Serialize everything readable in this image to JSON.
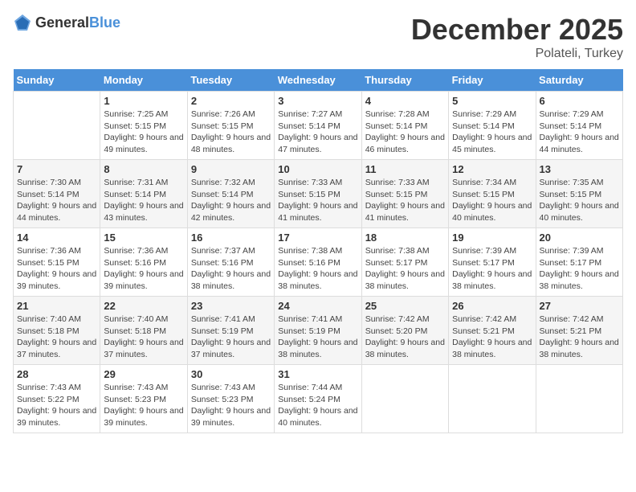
{
  "logo": {
    "text_general": "General",
    "text_blue": "Blue"
  },
  "header": {
    "month": "December 2025",
    "location": "Polateli, Turkey"
  },
  "weekdays": [
    "Sunday",
    "Monday",
    "Tuesday",
    "Wednesday",
    "Thursday",
    "Friday",
    "Saturday"
  ],
  "weeks": [
    [
      {
        "day": "",
        "sunrise": "",
        "sunset": "",
        "daylight": ""
      },
      {
        "day": "1",
        "sunrise": "Sunrise: 7:25 AM",
        "sunset": "Sunset: 5:15 PM",
        "daylight": "Daylight: 9 hours and 49 minutes."
      },
      {
        "day": "2",
        "sunrise": "Sunrise: 7:26 AM",
        "sunset": "Sunset: 5:15 PM",
        "daylight": "Daylight: 9 hours and 48 minutes."
      },
      {
        "day": "3",
        "sunrise": "Sunrise: 7:27 AM",
        "sunset": "Sunset: 5:14 PM",
        "daylight": "Daylight: 9 hours and 47 minutes."
      },
      {
        "day": "4",
        "sunrise": "Sunrise: 7:28 AM",
        "sunset": "Sunset: 5:14 PM",
        "daylight": "Daylight: 9 hours and 46 minutes."
      },
      {
        "day": "5",
        "sunrise": "Sunrise: 7:29 AM",
        "sunset": "Sunset: 5:14 PM",
        "daylight": "Daylight: 9 hours and 45 minutes."
      },
      {
        "day": "6",
        "sunrise": "Sunrise: 7:29 AM",
        "sunset": "Sunset: 5:14 PM",
        "daylight": "Daylight: 9 hours and 44 minutes."
      }
    ],
    [
      {
        "day": "7",
        "sunrise": "Sunrise: 7:30 AM",
        "sunset": "Sunset: 5:14 PM",
        "daylight": "Daylight: 9 hours and 44 minutes."
      },
      {
        "day": "8",
        "sunrise": "Sunrise: 7:31 AM",
        "sunset": "Sunset: 5:14 PM",
        "daylight": "Daylight: 9 hours and 43 minutes."
      },
      {
        "day": "9",
        "sunrise": "Sunrise: 7:32 AM",
        "sunset": "Sunset: 5:14 PM",
        "daylight": "Daylight: 9 hours and 42 minutes."
      },
      {
        "day": "10",
        "sunrise": "Sunrise: 7:33 AM",
        "sunset": "Sunset: 5:15 PM",
        "daylight": "Daylight: 9 hours and 41 minutes."
      },
      {
        "day": "11",
        "sunrise": "Sunrise: 7:33 AM",
        "sunset": "Sunset: 5:15 PM",
        "daylight": "Daylight: 9 hours and 41 minutes."
      },
      {
        "day": "12",
        "sunrise": "Sunrise: 7:34 AM",
        "sunset": "Sunset: 5:15 PM",
        "daylight": "Daylight: 9 hours and 40 minutes."
      },
      {
        "day": "13",
        "sunrise": "Sunrise: 7:35 AM",
        "sunset": "Sunset: 5:15 PM",
        "daylight": "Daylight: 9 hours and 40 minutes."
      }
    ],
    [
      {
        "day": "14",
        "sunrise": "Sunrise: 7:36 AM",
        "sunset": "Sunset: 5:15 PM",
        "daylight": "Daylight: 9 hours and 39 minutes."
      },
      {
        "day": "15",
        "sunrise": "Sunrise: 7:36 AM",
        "sunset": "Sunset: 5:16 PM",
        "daylight": "Daylight: 9 hours and 39 minutes."
      },
      {
        "day": "16",
        "sunrise": "Sunrise: 7:37 AM",
        "sunset": "Sunset: 5:16 PM",
        "daylight": "Daylight: 9 hours and 38 minutes."
      },
      {
        "day": "17",
        "sunrise": "Sunrise: 7:38 AM",
        "sunset": "Sunset: 5:16 PM",
        "daylight": "Daylight: 9 hours and 38 minutes."
      },
      {
        "day": "18",
        "sunrise": "Sunrise: 7:38 AM",
        "sunset": "Sunset: 5:17 PM",
        "daylight": "Daylight: 9 hours and 38 minutes."
      },
      {
        "day": "19",
        "sunrise": "Sunrise: 7:39 AM",
        "sunset": "Sunset: 5:17 PM",
        "daylight": "Daylight: 9 hours and 38 minutes."
      },
      {
        "day": "20",
        "sunrise": "Sunrise: 7:39 AM",
        "sunset": "Sunset: 5:17 PM",
        "daylight": "Daylight: 9 hours and 38 minutes."
      }
    ],
    [
      {
        "day": "21",
        "sunrise": "Sunrise: 7:40 AM",
        "sunset": "Sunset: 5:18 PM",
        "daylight": "Daylight: 9 hours and 37 minutes."
      },
      {
        "day": "22",
        "sunrise": "Sunrise: 7:40 AM",
        "sunset": "Sunset: 5:18 PM",
        "daylight": "Daylight: 9 hours and 37 minutes."
      },
      {
        "day": "23",
        "sunrise": "Sunrise: 7:41 AM",
        "sunset": "Sunset: 5:19 PM",
        "daylight": "Daylight: 9 hours and 37 minutes."
      },
      {
        "day": "24",
        "sunrise": "Sunrise: 7:41 AM",
        "sunset": "Sunset: 5:19 PM",
        "daylight": "Daylight: 9 hours and 38 minutes."
      },
      {
        "day": "25",
        "sunrise": "Sunrise: 7:42 AM",
        "sunset": "Sunset: 5:20 PM",
        "daylight": "Daylight: 9 hours and 38 minutes."
      },
      {
        "day": "26",
        "sunrise": "Sunrise: 7:42 AM",
        "sunset": "Sunset: 5:21 PM",
        "daylight": "Daylight: 9 hours and 38 minutes."
      },
      {
        "day": "27",
        "sunrise": "Sunrise: 7:42 AM",
        "sunset": "Sunset: 5:21 PM",
        "daylight": "Daylight: 9 hours and 38 minutes."
      }
    ],
    [
      {
        "day": "28",
        "sunrise": "Sunrise: 7:43 AM",
        "sunset": "Sunset: 5:22 PM",
        "daylight": "Daylight: 9 hours and 39 minutes."
      },
      {
        "day": "29",
        "sunrise": "Sunrise: 7:43 AM",
        "sunset": "Sunset: 5:23 PM",
        "daylight": "Daylight: 9 hours and 39 minutes."
      },
      {
        "day": "30",
        "sunrise": "Sunrise: 7:43 AM",
        "sunset": "Sunset: 5:23 PM",
        "daylight": "Daylight: 9 hours and 39 minutes."
      },
      {
        "day": "31",
        "sunrise": "Sunrise: 7:44 AM",
        "sunset": "Sunset: 5:24 PM",
        "daylight": "Daylight: 9 hours and 40 minutes."
      },
      {
        "day": "",
        "sunrise": "",
        "sunset": "",
        "daylight": ""
      },
      {
        "day": "",
        "sunrise": "",
        "sunset": "",
        "daylight": ""
      },
      {
        "day": "",
        "sunrise": "",
        "sunset": "",
        "daylight": ""
      }
    ]
  ]
}
